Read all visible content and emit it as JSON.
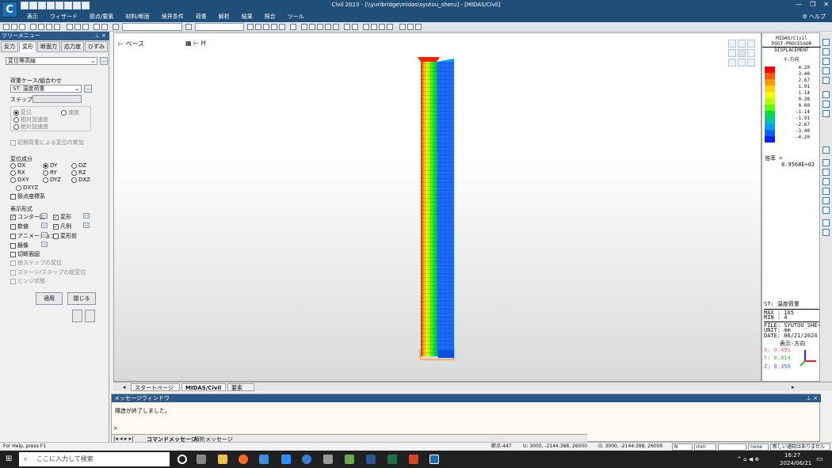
{
  "window": {
    "title": "Civil 2023 - [\\\\yuribridge\\midas\\syutou_sheru] - [MIDAS/Civil]",
    "controls": [
      "—",
      "❐",
      "✕"
    ]
  },
  "menu": {
    "items": [
      "表示",
      "ウィザード",
      "節点/要素",
      "材料/断面",
      "境界条件",
      "荷重",
      "解析",
      "結果",
      "照合",
      "ツール"
    ],
    "help": "ヘルプ"
  },
  "left_panel": {
    "title": "ツリーメニュー",
    "tabs": [
      "反力",
      "変形",
      "断面力",
      "応力度",
      "ひずみ"
    ],
    "active_tab": 1,
    "view_type": "変位等高線",
    "load_case_label": "荷重ケース/組合わせ",
    "load_case_value": "ST: 温度荷重",
    "step_label": "ステップ",
    "analysis_type": {
      "options": [
        "変位",
        "速度",
        "相対加速度",
        "絶対加速度"
      ],
      "selected": 0
    },
    "initial_disp_label": "初期荷重による変位の累加",
    "components_label": "変位成分",
    "components": [
      "DX",
      "DY",
      "DZ",
      "RX",
      "RY",
      "RZ",
      "DXY",
      "DYZ",
      "DXZ",
      "DXYZ"
    ],
    "selected_component": "DY",
    "local_axis_label": "節点座標系",
    "display_label": "表示形式",
    "display_options": [
      {
        "label": "コンター図",
        "checked": true
      },
      {
        "label": "変形",
        "checked": true
      },
      {
        "label": "数値",
        "checked": false
      },
      {
        "label": "凡例",
        "checked": true
      },
      {
        "label": "アニメーション",
        "checked": false
      },
      {
        "label": "変形前",
        "checked": false
      },
      {
        "label": "鏡像",
        "checked": false
      },
      {
        "label": "切断面図",
        "checked": false
      }
    ],
    "disabled_options": [
      "他ステップの変位",
      "ステージ/ステップの総変位",
      "ヒンジ状態"
    ],
    "apply_button": "適用",
    "close_button": "閉じる"
  },
  "viewport": {
    "label_left": "ベース",
    "label_right": "H"
  },
  "legend": {
    "header": [
      "MIDAS/Civil",
      "POST-PROCESSOR",
      "DISPLACEMENT",
      "Y-方向"
    ],
    "values": [
      "4.20",
      "3.40",
      "2.67",
      "1.91",
      "1.14",
      "0.38",
      "0.00",
      "-1.14",
      "-1.91",
      "-2.67",
      "-3.40",
      "-4.20"
    ],
    "colors": [
      "#ff0000",
      "#ff5a00",
      "#ff9a00",
      "#ffd200",
      "#f4ff00",
      "#b8ff00",
      "#5aff00",
      "#00e040",
      "#00c8a0",
      "#00a0ff",
      "#0064ff",
      "#0020ff"
    ],
    "scale_label": "倍率 =",
    "scale_value": "8.9568E+02",
    "info": [
      "ST: 温度荷重",
      "MAX : 165",
      "MIN : 4",
      "FILE: SYUTOU_SHE~",
      "UNIT: mm",
      "DATE: 06/21/2024"
    ],
    "view_dir_label": "表示-方向",
    "axes": {
      "x": "X: 0.491",
      "y": "Y: 0.814",
      "z": "Z: 0.359"
    }
  },
  "doc_tabs": [
    "スタートページ",
    "MIDAS/Civil",
    "要素"
  ],
  "messages": {
    "title": "メッセージウィンドウ",
    "lines": [
      "構造が終了しました。"
    ],
    "prompt": ">",
    "tabs": [
      "コマンドメッセージ",
      "解析メッセージ"
    ]
  },
  "status": {
    "help": "For Help, press F1",
    "node": "節点-447",
    "u": "U: 3000, -2144.388, 26000",
    "g": "G: 3000, -2144.388, 26000",
    "frame": "N",
    "unit": "mm",
    "filter": "none",
    "notice": "新しい通知はありません"
  },
  "taskbar": {
    "search_placeholder": "ここに入力して検索",
    "time": "16:27",
    "date": "2024/06/21"
  }
}
